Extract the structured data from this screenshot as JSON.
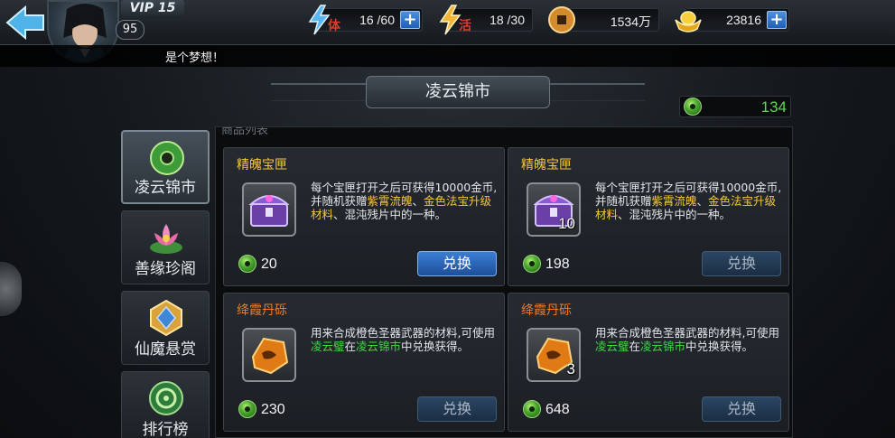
{
  "header": {
    "vip_label": "VIP 15",
    "player_level": "95",
    "resources": [
      {
        "name": "stamina",
        "tag": "体",
        "value": "16 /60",
        "icon": "lightning-icon",
        "has_plus": true
      },
      {
        "name": "vitality",
        "tag": "活",
        "value": "18 /30",
        "icon": "lightning-icon",
        "has_plus": false
      },
      {
        "name": "copper",
        "value": "1534万",
        "icon": "copper-coin-icon",
        "has_plus": false
      },
      {
        "name": "gold",
        "value": "23816",
        "icon": "gold-ingot-icon",
        "has_plus": true
      }
    ]
  },
  "marquee": {
    "text": "是个梦想！"
  },
  "shop": {
    "title": "凌云锦市",
    "currency_value": "134",
    "panel_heading": "商品列表"
  },
  "side_tabs": [
    {
      "label": "凌云锦市",
      "icon": "jade-disc-icon",
      "active": true
    },
    {
      "label": "善缘珍阁",
      "icon": "lotus-icon",
      "active": false
    },
    {
      "label": "仙魔悬赏",
      "icon": "bounty-crest-icon",
      "active": false
    },
    {
      "label": "排行榜",
      "icon": "ranking-disc-icon",
      "active": false
    }
  ],
  "items": [
    {
      "name": "精魄宝匣",
      "name_color": "yellow",
      "icon": "treasure-chest-icon",
      "count": "",
      "desc_parts": [
        "每个宝匣打开之后可获得10000金币,并随机获赠",
        "紫霄流魄",
        "、",
        "金色法宝升级材料",
        "、混沌残片中的一种。"
      ],
      "price": "20",
      "button": "兑换",
      "button_enabled": true
    },
    {
      "name": "精魄宝匣",
      "name_color": "yellow",
      "icon": "treasure-chest-icon",
      "count": "10",
      "desc_parts": [
        "每个宝匣打开之后可获得10000金币,并随机获赠",
        "紫霄流魄",
        "、",
        "金色法宝升级材料",
        "、混沌残片中的一种。"
      ],
      "price": "198",
      "button": "兑换",
      "button_enabled": false
    },
    {
      "name": "绛霞丹砾",
      "name_color": "orange",
      "icon": "orange-stone-icon",
      "count": "",
      "desc_parts": [
        "用来合成橙色圣器武器的材料,可使用",
        "凌云璧",
        "在",
        "凌云锦市",
        "中兑换获得。"
      ],
      "price": "230",
      "button": "兑换",
      "button_enabled": false
    },
    {
      "name": "绛霞丹砾",
      "name_color": "orange",
      "icon": "orange-stone-icon",
      "count": "3",
      "desc_parts": [
        "用来合成橙色圣器武器的材料,可使用",
        "凌云璧",
        "在",
        "凌云锦市",
        "中兑换获得。"
      ],
      "price": "648",
      "button": "兑换",
      "button_enabled": false
    }
  ]
}
